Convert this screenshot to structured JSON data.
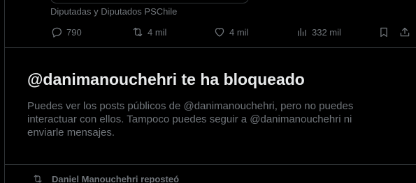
{
  "quoted_post": {
    "caption": "Diputadas y Diputados PSChile"
  },
  "actions": {
    "reply": {
      "count": "790",
      "icon": "reply-icon"
    },
    "repost": {
      "count": "4 mil",
      "icon": "repost-icon"
    },
    "like": {
      "count": "4 mil",
      "icon": "heart-icon"
    },
    "views": {
      "count": "332 mil",
      "icon": "views-icon"
    },
    "bookmark": {
      "icon": "bookmark-icon"
    },
    "share": {
      "icon": "share-icon"
    }
  },
  "blocked_notice": {
    "title": "@danimanouchehri te ha bloqueado",
    "body": "Puedes ver los posts públicos de @danimanouchehri, pero no puedes interactuar con ellos. Tampoco puedes seguir a @danimanouchehri ni enviarle mensajes."
  },
  "next_post": {
    "repost_label": "Daniel Manouchehri reposteó",
    "icon": "repost-icon"
  },
  "colors": {
    "background": "#000000",
    "primary_text": "#e7e9ea",
    "secondary_text": "#71767b",
    "border": "#2f3336"
  }
}
